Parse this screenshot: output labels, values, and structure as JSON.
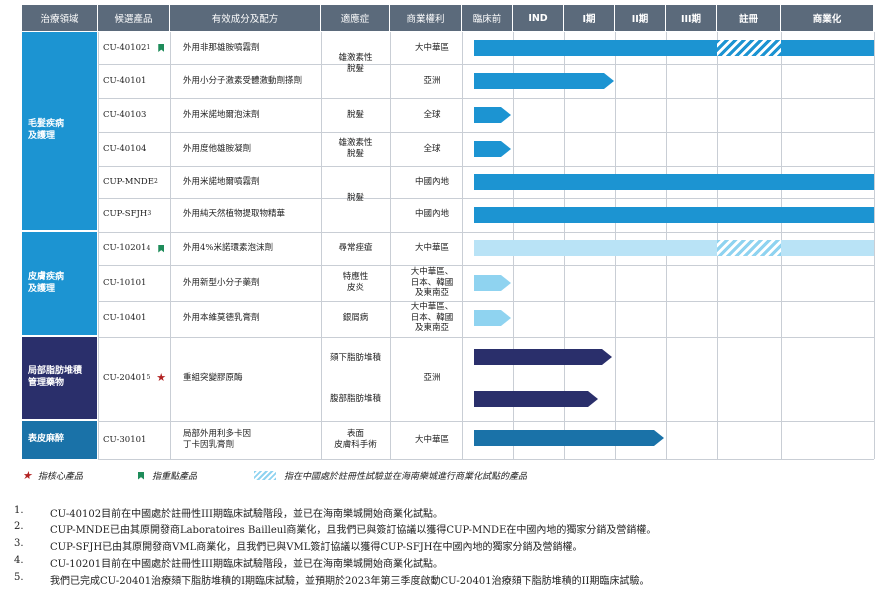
{
  "headers": {
    "area": "治療領域",
    "candidate": "候選產品",
    "formulation": "有效成分及配方",
    "indication": "適應症",
    "rights": "商業權利",
    "preclinical": "臨床前",
    "ind": "IND",
    "phase1": "I期",
    "phase2": "II期",
    "phase3": "III期",
    "registration": "註冊",
    "commercial": "商業化"
  },
  "categories": [
    {
      "name": "毛髮疾病\n及護理",
      "color": "#1c94d2"
    },
    {
      "name": "皮膚疾病\n及護理",
      "color": "#1c94d2"
    },
    {
      "name": "局部脂肪堆積\n管理藥物",
      "color": "#2a2f6b"
    },
    {
      "name": "表皮麻醉",
      "color": "#1a72a8"
    }
  ],
  "rows": [
    {
      "candidate": "CU-40102",
      "sup": "1",
      "marker": "flag",
      "formulation": "外用非那雄胺噴霧劑",
      "rights": "大中華區"
    },
    {
      "candidate": "CU-40101",
      "sup": "",
      "marker": "",
      "formulation": "外用小分子激素受體激動劑搽劑",
      "rights": "亞洲"
    },
    {
      "candidate": "CU-40103",
      "sup": "",
      "marker": "",
      "formulation": "外用米諾地爾泡沫劑",
      "rights": "全球"
    },
    {
      "candidate": "CU-40104",
      "sup": "",
      "marker": "",
      "formulation": "外用度他雄胺凝劑",
      "rights": "全球"
    },
    {
      "candidate": "CUP-MNDE",
      "sup": "2",
      "marker": "",
      "formulation": "外用米諾地爾噴霧劑",
      "rights": "中國內地"
    },
    {
      "candidate": "CUP-SFJH",
      "sup": "3",
      "marker": "",
      "formulation": "外用純天然植物提取物精華",
      "rights": "中國內地"
    },
    {
      "candidate": "CU-10201",
      "sup": "4",
      "marker": "flag",
      "formulation": "外用4%米諾環素泡沫劑",
      "rights": "大中華區"
    },
    {
      "candidate": "CU-10101",
      "sup": "",
      "marker": "",
      "formulation": "外用新型小分子藥劑",
      "rights": "大中華區、\n日本、韓國\n及東南亞"
    },
    {
      "candidate": "CU-10401",
      "sup": "",
      "marker": "",
      "formulation": "外用本維莫德乳膏劑",
      "rights": "大中華區、\n日本、韓國\n及東南亞"
    },
    {
      "candidate": "CU-20401",
      "sup": "5",
      "marker": "star",
      "formulation": "重組突變膠原酶",
      "rights": "亞洲"
    },
    {
      "candidate": "CU-30101",
      "sup": "",
      "marker": "",
      "formulation": "局部外用利多卡因\n丁卡因乳膏劑",
      "rights": "大中華區"
    }
  ],
  "indications": [
    {
      "text": "雄激素性\n脫髮"
    },
    {
      "text": "脫髮"
    },
    {
      "text": "雄激素性\n脫髮"
    },
    {
      "text": "脫髮"
    },
    {
      "text": "尋常痤瘡"
    },
    {
      "text": "特應性\n皮炎"
    },
    {
      "text": "銀屑病"
    },
    {
      "text": "頦下脂肪堆積"
    },
    {
      "text": "腹部脂肪堆積"
    },
    {
      "text": "表面\n皮膚科手術"
    }
  ],
  "progress": [
    {
      "row": "CU-40102",
      "stage": "商業化",
      "hatched_stage": "註冊"
    },
    {
      "row": "CU-40101",
      "stage": "I期"
    },
    {
      "row": "CU-40103",
      "stage": "臨床前"
    },
    {
      "row": "CU-40104",
      "stage": "臨床前"
    },
    {
      "row": "CUP-MNDE",
      "stage": "商業化"
    },
    {
      "row": "CUP-SFJH",
      "stage": "商業化"
    },
    {
      "row": "CU-10201",
      "stage": "商業化",
      "hatched_stage": "註冊"
    },
    {
      "row": "CU-10101",
      "stage": "臨床前"
    },
    {
      "row": "CU-10401",
      "stage": "臨床前"
    },
    {
      "row": "CU-20401 頦下脂肪堆積",
      "stage": "I期"
    },
    {
      "row": "CU-20401 腹部脂肪堆積",
      "stage": "IND"
    },
    {
      "row": "CU-30101",
      "stage": "II期"
    }
  ],
  "legend": {
    "core": "指核心產品",
    "key": "指重點產品",
    "hatched": "指在中國處於註冊性試驗並在海南樂城進行商業化試點的產品"
  },
  "notes": [
    {
      "num": "1.",
      "text": "CU-40102目前在中國處於註冊性III期臨床試驗階段，並已在海南樂城開始商業化試點。"
    },
    {
      "num": "2.",
      "text": "CUP-MNDE已由其原開發商Laboratoires Bailleul商業化，且我們已與簽訂協議以獲得CUP-MNDE在中國內地的獨家分銷及營銷權。"
    },
    {
      "num": "3.",
      "text": "CUP-SFJH已由其原開發商VML商業化，且我們已與VML簽訂協議以獲得CUP-SFJH在中國內地的獨家分銷及營銷權。"
    },
    {
      "num": "4.",
      "text": "CU-10201目前在中國處於註冊性III期臨床試驗階段，並已在海南樂城開始商業化試點。"
    },
    {
      "num": "5.",
      "text": "我們已完成CU-20401治療頦下脂肪堆積的I期臨床試驗，並預期於2023年第三季度啟動CU-20401治療頦下脂肪堆積的II期臨床試驗。"
    }
  ],
  "colors": {
    "header": "#5b6a7b",
    "hair": "#1c94d2",
    "skin_bar": "#8fd3f0",
    "fat": "#2a2f6b",
    "anesth": "#1a72a8"
  }
}
